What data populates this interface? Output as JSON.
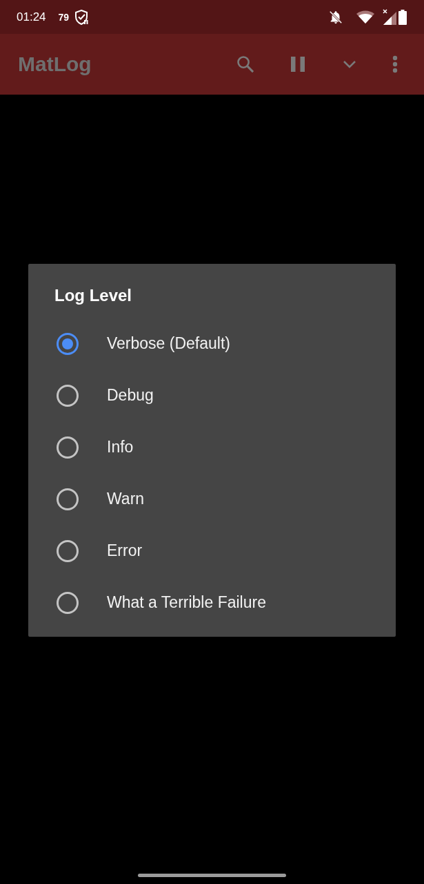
{
  "status_bar": {
    "time": "01:24",
    "notification_count": "79"
  },
  "app_bar": {
    "title": "MatLog"
  },
  "dialog": {
    "title": "Log Level",
    "options": [
      {
        "label": "Verbose (Default)",
        "selected": true
      },
      {
        "label": "Debug",
        "selected": false
      },
      {
        "label": "Info",
        "selected": false
      },
      {
        "label": "Warn",
        "selected": false
      },
      {
        "label": "Error",
        "selected": false
      },
      {
        "label": "What a Terrible Failure",
        "selected": false
      }
    ]
  }
}
